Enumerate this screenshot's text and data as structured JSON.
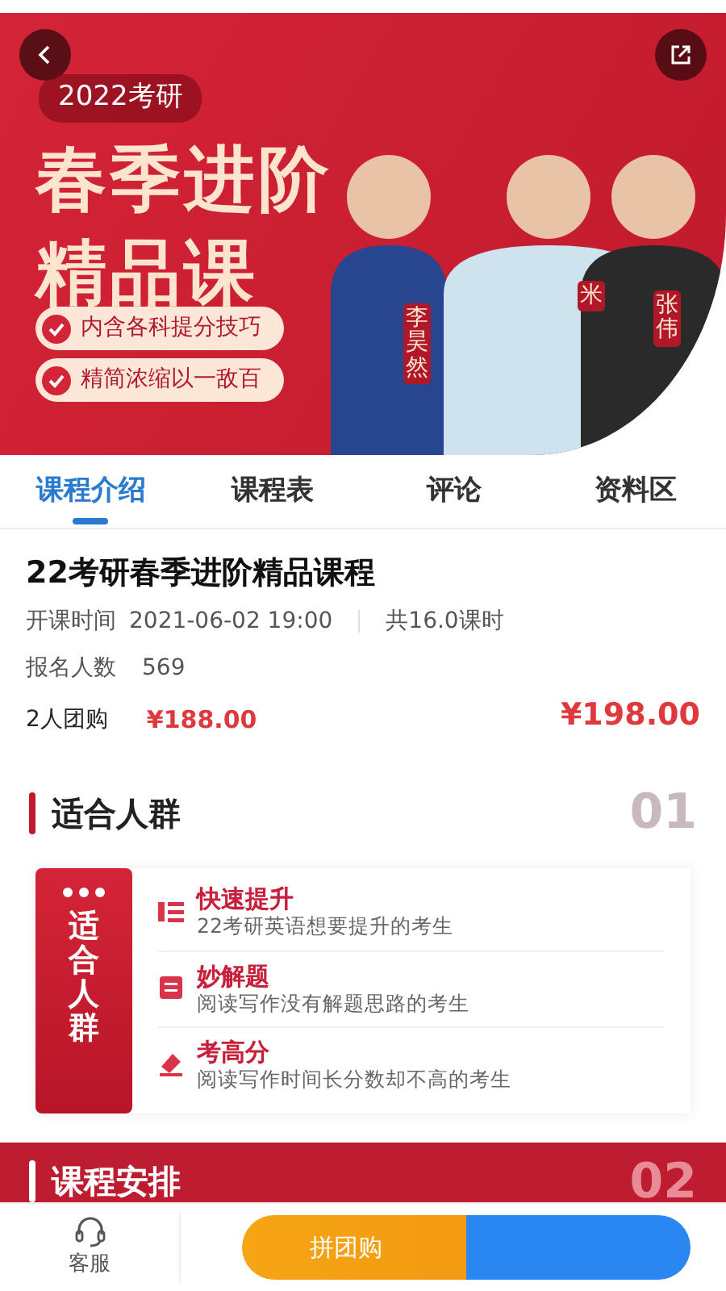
{
  "banner": {
    "tag": "2022考研",
    "headline": [
      "春季进阶",
      "精品课"
    ],
    "points": [
      "内含各科提分技巧",
      "精简浓缩以一敌百"
    ],
    "teachers": [
      "李昊然",
      "米",
      "张伟"
    ]
  },
  "tabs": [
    {
      "label": "课程介绍",
      "selected": true
    },
    {
      "label": "课程表",
      "selected": false
    },
    {
      "label": "评论",
      "selected": false
    },
    {
      "label": "资料区",
      "selected": false
    }
  ],
  "course": {
    "title": "22考研春季进阶精品课程",
    "start_label": "开课时间",
    "start_time": "2021-06-02 19:00",
    "hours": "共16.0课时",
    "enroll_label": "报名人数",
    "enroll_count": "569",
    "group_label": "2人团购",
    "group_price": "¥188.00",
    "price": "¥198.00"
  },
  "sections": [
    {
      "title": "适合人群",
      "number": "01",
      "side_label": "适合人群",
      "items": [
        {
          "kind": "list",
          "title": "快速提升",
          "desc": "22考研英语想要提升的考生"
        },
        {
          "kind": "doc",
          "title": "妙解题",
          "desc": "阅读写作没有解题思路的考生"
        },
        {
          "kind": "pen",
          "title": "考高分",
          "desc": "阅读写作时间长分数却不高的考生"
        }
      ]
    },
    {
      "title": "课程安排",
      "number": "02"
    }
  ],
  "bottom_bar": {
    "service": "客服",
    "group_button": "拼团购"
  }
}
